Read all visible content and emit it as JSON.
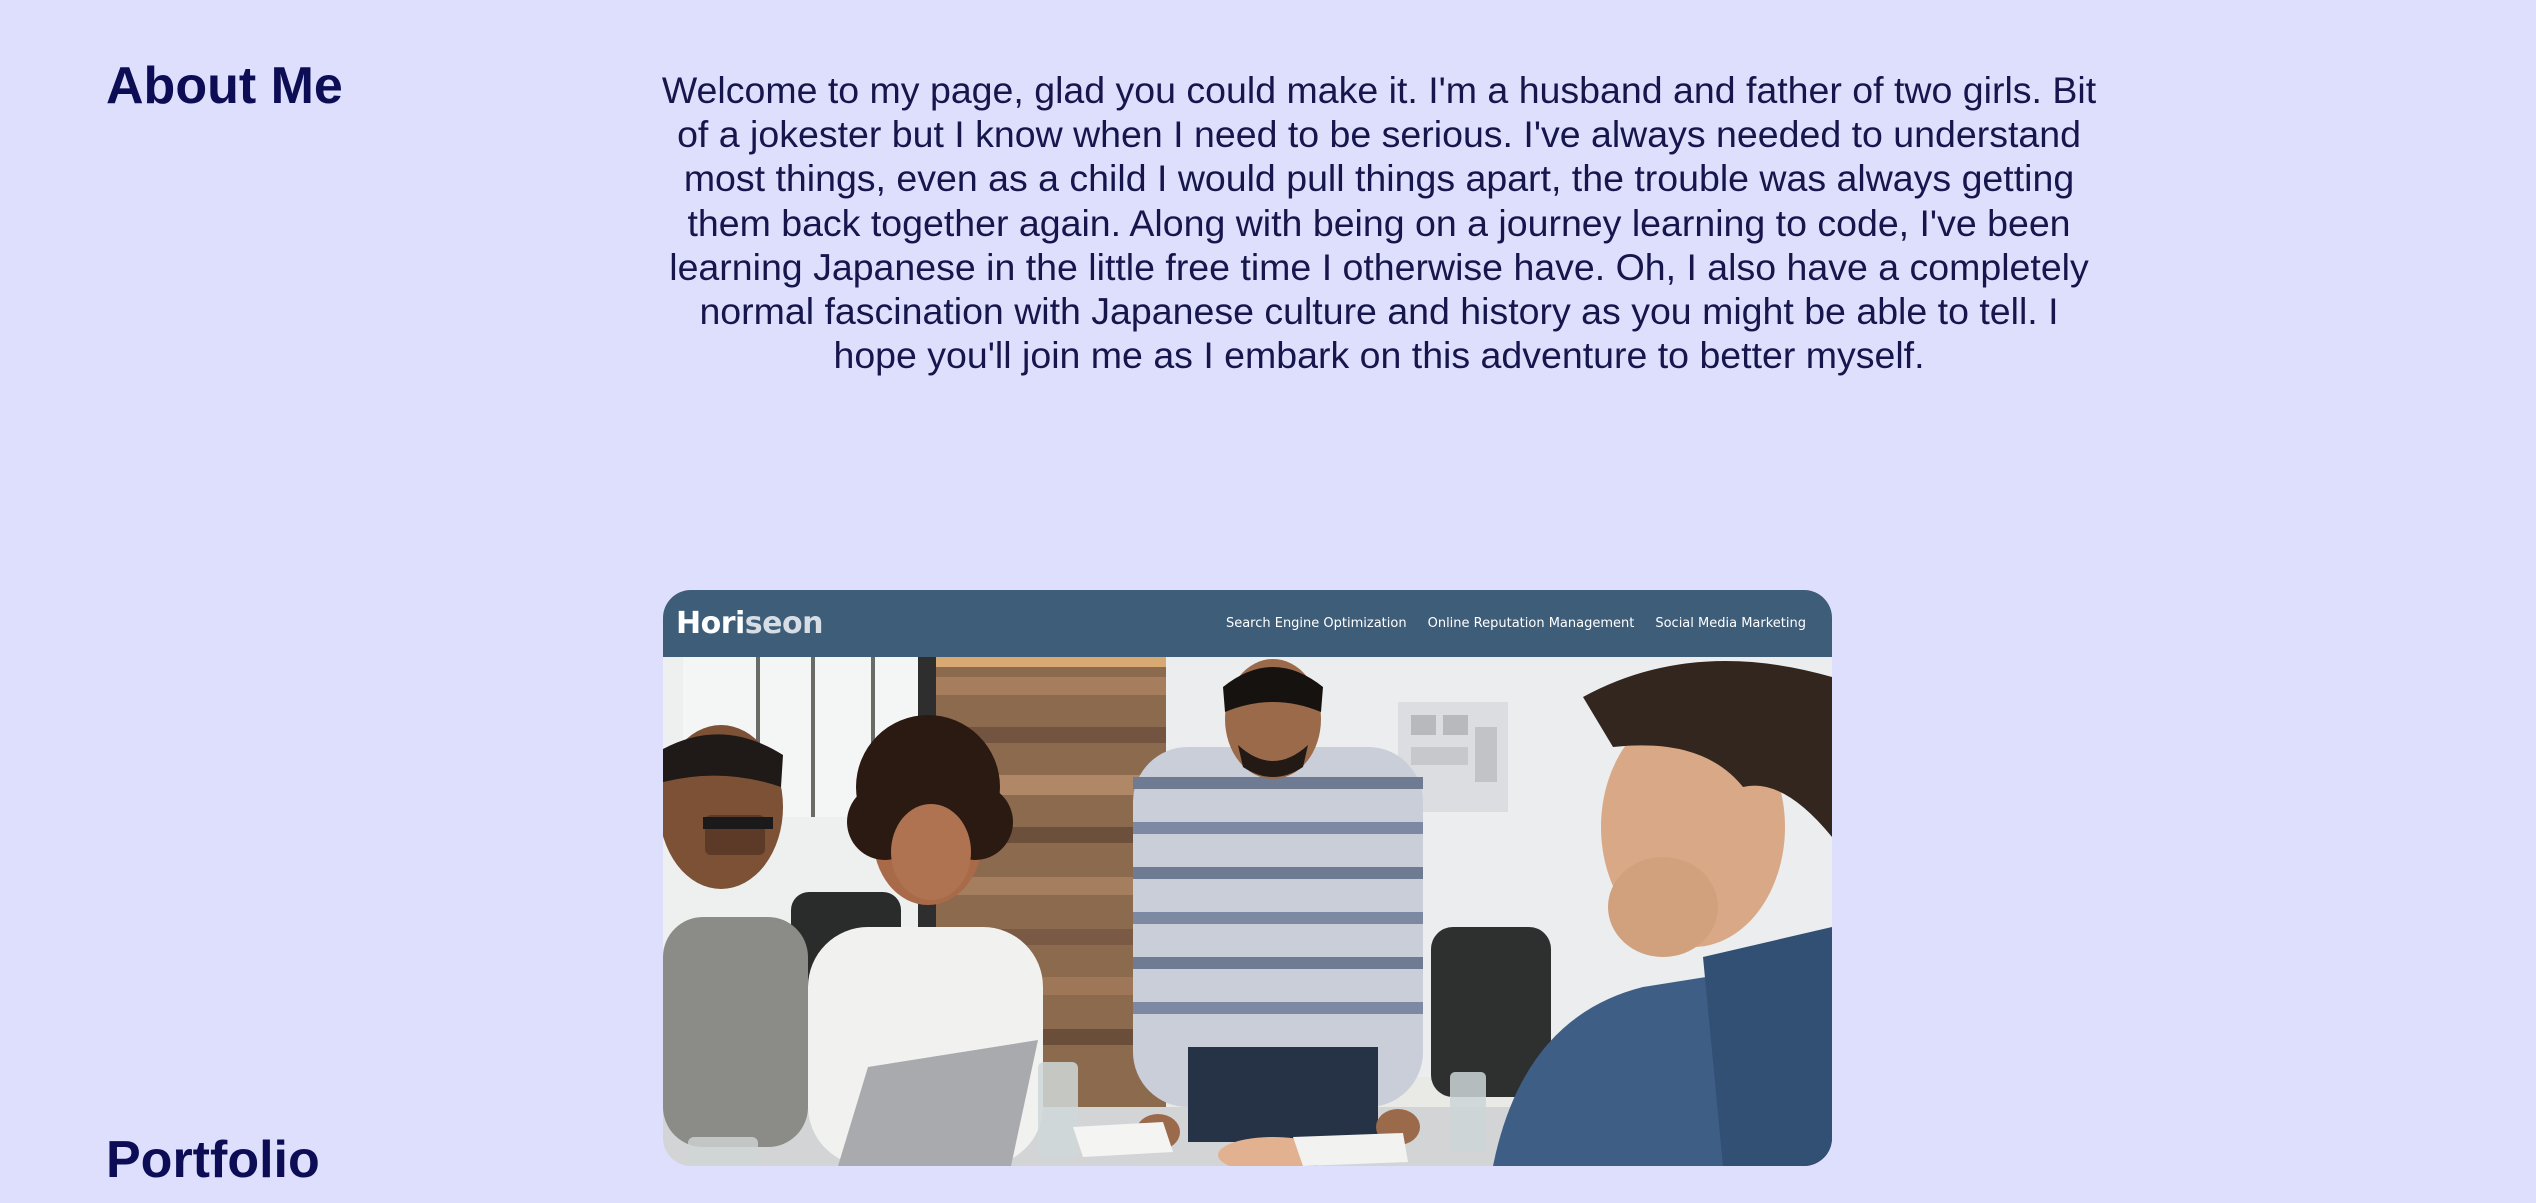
{
  "about": {
    "heading": "About Me",
    "text": "Welcome to my page, glad you could make it. I'm a husband and father of two girls. Bit of a jokester but I know when I need to be serious. I've always needed to understand most things, even as a child I would pull things apart, the trouble was always getting them back together again. Along with being on a journey learning to code, I've been learning Japanese in the little free time I otherwise have. Oh, I also have a completely normal fascination with Japanese culture and history as you might be able to tell. I hope you'll join me as I embark on this adventure to better myself."
  },
  "portfolio": {
    "heading": "Portfolio",
    "project": {
      "logo_part1": "Hori",
      "logo_part2": "seon",
      "nav": [
        "Search Engine Optimization",
        "Online Reputation Management",
        "Social Media Marketing"
      ]
    }
  },
  "colors": {
    "page_background": "#dedefd",
    "heading_text": "#0d0d55",
    "project_header": "#3e5d78"
  }
}
